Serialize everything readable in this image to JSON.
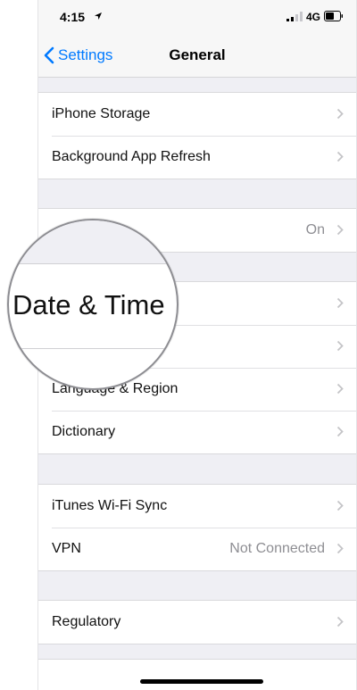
{
  "status": {
    "time": "4:15",
    "network": "4G"
  },
  "nav": {
    "back_label": "Settings",
    "title": "General"
  },
  "group1": [
    {
      "label": "iPhone Storage"
    },
    {
      "label": "Background App Refresh"
    }
  ],
  "group2": [
    {
      "label": "",
      "value": "On"
    }
  ],
  "group3": [
    {
      "label": ""
    },
    {
      "label": ""
    },
    {
      "label": "Language & Region"
    },
    {
      "label": "Dictionary"
    }
  ],
  "group4": [
    {
      "label": "iTunes Wi-Fi Sync"
    },
    {
      "label": "VPN",
      "value": "Not Connected"
    }
  ],
  "group5": [
    {
      "label": "Regulatory"
    }
  ],
  "magnifier": {
    "text": "Date & Time"
  },
  "colors": {
    "accent": "#007aff",
    "background": "#efeff4",
    "secondary_text": "#8e8e93"
  },
  "icons": [
    "location-arrow-icon",
    "signal-bars-icon",
    "battery-icon",
    "chevron-left-icon",
    "chevron-right-icon"
  ]
}
